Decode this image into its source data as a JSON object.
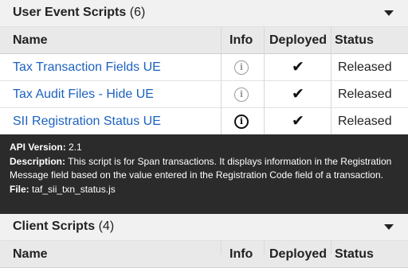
{
  "user_event_scripts": {
    "title": "User Event Scripts",
    "count": "(6)",
    "columns": {
      "name": "Name",
      "info": "Info",
      "deployed": "Deployed",
      "status": "Status"
    },
    "rows": [
      {
        "name": "Tax Transaction Fields UE",
        "deployed": "✔",
        "status": "Released",
        "info_icon": "info-icon"
      },
      {
        "name": "Tax Audit Files - Hide UE",
        "deployed": "✔",
        "status": "Released",
        "info_icon": "info-icon"
      },
      {
        "name": "SII Registration Status UE",
        "deployed": "✔",
        "status": "Released",
        "info_icon": "info-icon"
      }
    ]
  },
  "tooltip": {
    "api_version_label": "API Version:",
    "api_version": "2.1",
    "description_label": "Description:",
    "description": "This script is for Span transactions. It displays information in the Registration Message field based on the value entered in the Registration Code field of a transaction.",
    "file_label": "File:",
    "file": "taf_sii_txn_status.js"
  },
  "client_scripts": {
    "title": "Client Scripts",
    "count": "(4)",
    "columns": {
      "name": "Name",
      "info": "Info",
      "deployed": "Deployed",
      "status": "Status"
    }
  },
  "colors": {
    "link": "#1c62bf",
    "header_bg": "#f1f1f1",
    "column_header_bg": "#e9e9e9",
    "tooltip_bg": "#2b2b2b"
  }
}
